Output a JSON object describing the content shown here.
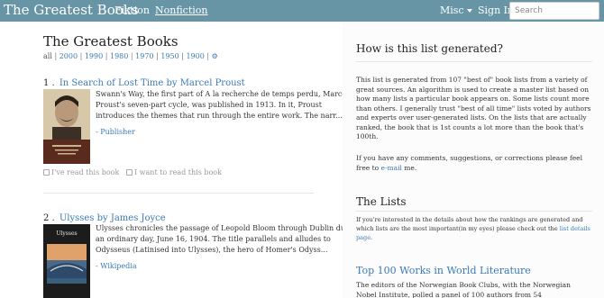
{
  "navbar": {
    "brand": "The Greatest Books",
    "links": [
      "Fiction",
      "Nonfiction"
    ],
    "misc": "Misc",
    "signin": "Sign In",
    "search_placeholder": "Search"
  },
  "main": {
    "title": "The Greatest Books",
    "filters": [
      "all",
      "2000",
      "1990",
      "1980",
      "1970",
      "1950",
      "1900"
    ],
    "settings_icon": "gear-icon",
    "books": [
      {
        "number": "1 .",
        "title": "In Search of Lost Time by Marcel Proust",
        "description": "Swann's Way, the first part of A la recherche de temps perdu, Marcel Proust's seven-part cycle, was published in 1913. In it, Proust introduces the themes that run through the entire work. The narr...",
        "link": "- Publisher",
        "read_label": "I've read this book",
        "want_label": "I want to read this book"
      },
      {
        "number": "2 .",
        "title": "Ulysses by James Joyce",
        "description": "Ulysses chronicles the passage of Leopold Bloom through Dublin during an ordinary day, June 16, 1904. The title parallels and alludes to Odysseus (Latinised into Ulysses), the hero of Homer's Odyss...",
        "link": "- Wikipedia",
        "cover_title": "Ulysses"
      }
    ]
  },
  "sidebar": {
    "how_title": "How is this list generated?",
    "how_text": "This list is generated from 107 \"best of\" book lists from a variety of great sources. An algorithm is used to create a master list based on how many lists a particular book appears on. Some lists count more than others. I generally trust \"best of all time\" lists voted by authors and experts over user-generated lists. On the lists that are actually ranked, the book that is 1st counts a lot more than the book that's 100th.",
    "contact_prefix": "If you have any comments, suggestions, or corrections please feel free to ",
    "contact_link": "e-mail",
    "contact_suffix": " me.",
    "lists_title": "The Lists",
    "lists_prefix": "If you're interested in the details about how the rankings are generated and which lists are the most important(in my eyes) please check out the ",
    "lists_link": "list details page",
    "lists_suffix": ".",
    "list1_title": "Top 100 Works in World Literature",
    "list1_text": "The editors of the Norwegian Book Clubs, with the Norwegian Nobel Institute, polled a panel of 100 authors from 54"
  }
}
